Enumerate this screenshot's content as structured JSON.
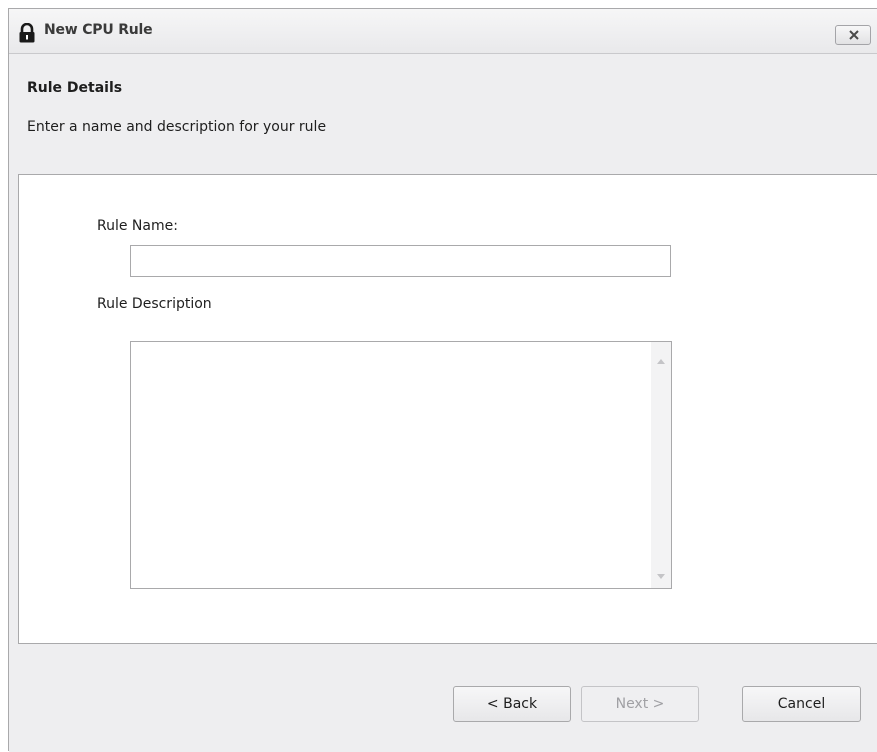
{
  "window": {
    "title": "New CPU Rule",
    "close_label": "x"
  },
  "header": {
    "title": "Rule Details",
    "subtitle": "Enter a name and description for your rule"
  },
  "form": {
    "name_label": "Rule Name:",
    "name_value": "",
    "description_label": "Rule Description",
    "description_value": ""
  },
  "footer": {
    "back_label": "< Back",
    "next_label": "Next >",
    "next_enabled": false,
    "cancel_label": "Cancel"
  },
  "icons": {
    "title_icon": "lock-icon",
    "close_icon": "close-icon",
    "scroll_up": "scroll-up-arrow-icon",
    "scroll_down": "scroll-down-arrow-icon"
  },
  "colors": {
    "window_bg": "#eeeef0",
    "content_bg": "#ffffff",
    "border": "#a9a9ab",
    "disabled_text": "#a0a0a4"
  }
}
